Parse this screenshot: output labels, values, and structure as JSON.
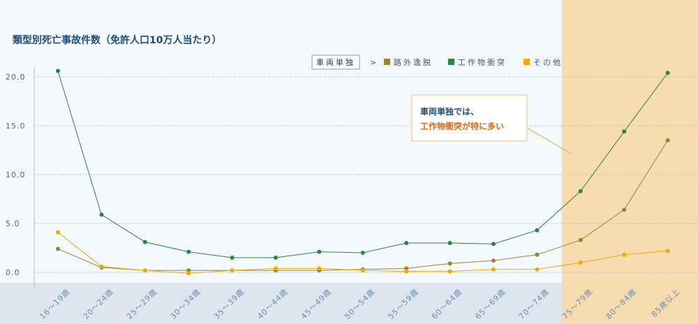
{
  "chart_data": {
    "type": "line",
    "title": "類型別死亡事故件数（免許人口10万人当たり）",
    "categories": [
      "16～19歳",
      "20～24歳",
      "25～29歳",
      "30～34歳",
      "35～39歳",
      "40～44歳",
      "45～49歳",
      "50～54歳",
      "55～59歳",
      "60～64歳",
      "65～69歳",
      "70～74歳",
      "75～79歳",
      "80～84歳",
      "85歳以上"
    ],
    "ylim": [
      0,
      20
    ],
    "yticks": [
      0,
      5,
      10,
      15,
      20
    ],
    "ytick_labels": [
      "0.0",
      "5.0",
      "10.0",
      "15.0",
      "20.0"
    ],
    "grid": true,
    "legend_group": "車両単独",
    "legend_arrow": ">",
    "legend_position": "top",
    "series": [
      {
        "name": "路外逸脱",
        "color": "#9a8430",
        "values": [
          2.4,
          0.5,
          0.2,
          0.2,
          0.2,
          0.2,
          0.2,
          0.3,
          0.4,
          0.9,
          1.2,
          1.8,
          3.3,
          6.4,
          13.5
        ]
      },
      {
        "name": "工作物衝突",
        "color": "#2e8540",
        "values": [
          20.6,
          5.9,
          3.1,
          2.1,
          1.5,
          1.5,
          2.1,
          2.0,
          3.0,
          3.0,
          2.9,
          4.3,
          8.3,
          14.4,
          20.4
        ]
      },
      {
        "name": "その他",
        "color": "#f5a800",
        "values": [
          4.1,
          0.6,
          0.2,
          -0.1,
          0.2,
          0.4,
          0.4,
          0.2,
          0.1,
          0.1,
          0.3,
          0.3,
          1.0,
          1.8,
          2.2
        ]
      }
    ],
    "highlight_categories": [
      "75～79歳",
      "80～84歳",
      "85歳以上"
    ],
    "annotation": {
      "line1": "車両単独では、",
      "line2": "工作物衝突が特に多い"
    }
  },
  "colors": {
    "plot_bg": "#f4f9fd",
    "highlight_bg": "#f7dcb0",
    "axis_band": "#dde6ee",
    "grid": "#b8c0c8"
  }
}
